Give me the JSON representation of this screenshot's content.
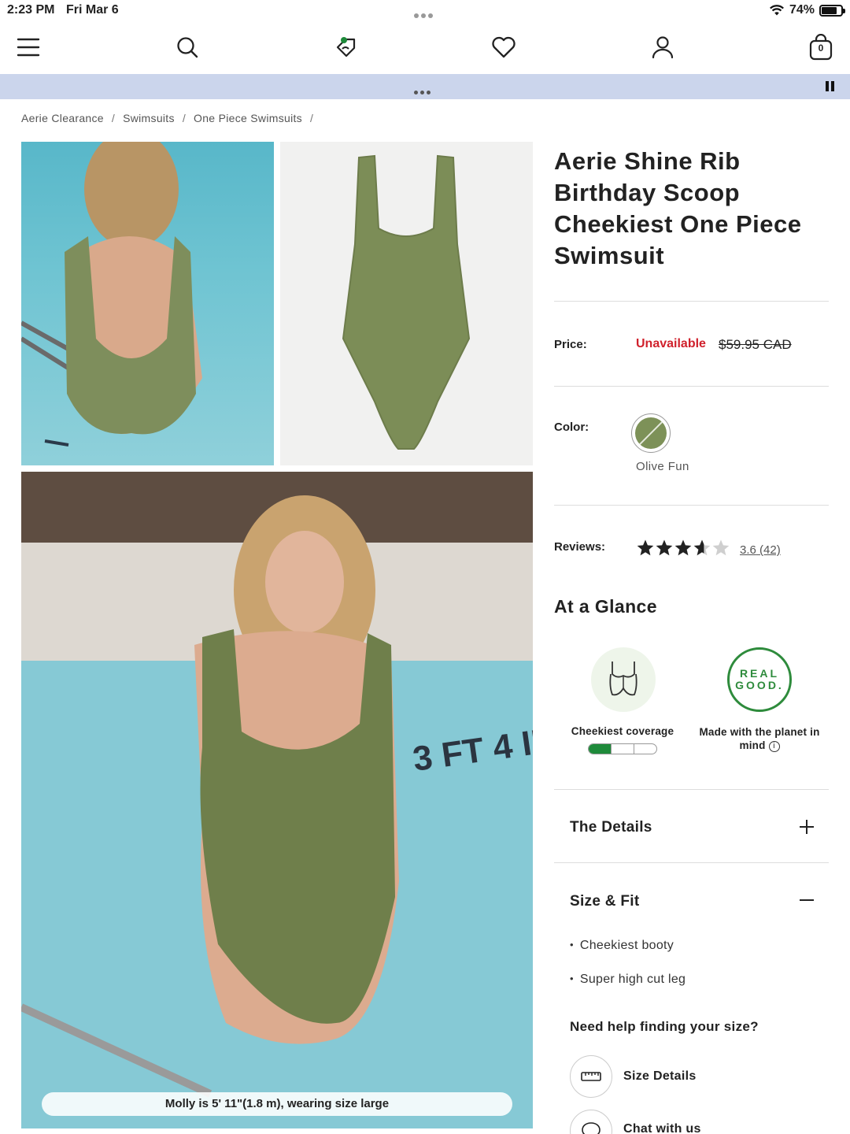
{
  "status_bar": {
    "time": "2:23 PM",
    "date": "Fri Mar 6",
    "battery": "74%",
    "battery_level": 0.74
  },
  "nav": {
    "icons": [
      "menu-icon",
      "search-icon",
      "rewards-tag-icon",
      "heart-icon",
      "account-icon",
      "bag-icon"
    ],
    "bag_count": "0"
  },
  "breadcrumb": [
    "Aerie Clearance",
    "Swimsuits",
    "One Piece Swimsuits"
  ],
  "breadcrumb_separator": "/",
  "gallery": {
    "caption": "Molly is 5' 11\"(1.8 m), wearing size large"
  },
  "product": {
    "title": "Aerie Shine Rib Birthday Scoop Cheekiest One Piece Swimsuit",
    "price_label": "Price:",
    "price_status": "Unavailable",
    "price_original": "$59.95 CAD",
    "color_label": "Color:",
    "color_name": "Olive Fun",
    "color_hex": "#7d9158",
    "reviews_label": "Reviews:",
    "rating": 3.6,
    "rating_text": "3.6",
    "review_count": "(42)"
  },
  "glance": {
    "heading": "At a Glance",
    "coverage_label": "Cheekiest coverage",
    "coverage_level": 1,
    "coverage_max": 3,
    "real_good_line1": "REAL",
    "real_good_line2": "GOOD.",
    "planet_label": "Made with the planet in mind",
    "info_glyph": "i"
  },
  "accordion": {
    "details_title": "The Details",
    "size_fit_title": "Size & Fit",
    "size_fit_bullets": [
      "Cheekiest booty",
      "Super high cut leg"
    ]
  },
  "help": {
    "heading": "Need help finding your size?",
    "size_details": "Size Details",
    "chat": "Chat with us"
  },
  "colors": {
    "accent_green": "#1e8a3a",
    "sale_red": "#d0212c",
    "promo_bg": "#cbd5ec"
  }
}
